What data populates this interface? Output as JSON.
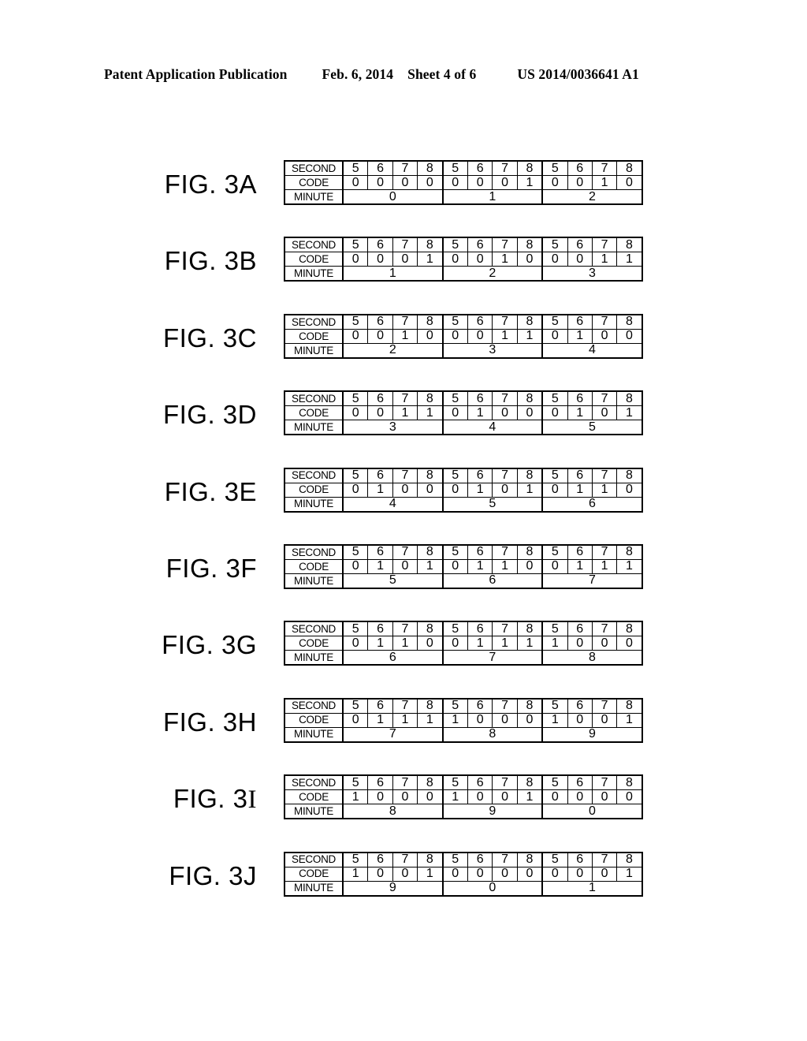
{
  "header": {
    "publication": "Patent Application Publication",
    "date": "Feb. 6, 2014",
    "sheet": "Sheet 4 of 6",
    "patent_number": "US 2014/0036641 A1"
  },
  "table_row_labels": {
    "second": "SECOND",
    "code": "CODE",
    "minute": "MINUTE"
  },
  "seconds_header": [
    "5",
    "6",
    "7",
    "8",
    "5",
    "6",
    "7",
    "8",
    "5",
    "6",
    "7",
    "8"
  ],
  "figures": [
    {
      "label_prefix": "FIG. 3",
      "label_suffix": "A",
      "label_full": "FIG. 3A",
      "second": [
        "5",
        "6",
        "7",
        "8",
        "5",
        "6",
        "7",
        "8",
        "5",
        "6",
        "7",
        "8"
      ],
      "code": [
        "0",
        "0",
        "0",
        "0",
        "0",
        "0",
        "0",
        "1",
        "0",
        "0",
        "1",
        "0"
      ],
      "minute": [
        "0",
        "1",
        "2"
      ]
    },
    {
      "label_prefix": "FIG. 3",
      "label_suffix": "B",
      "label_full": "FIG. 3B",
      "second": [
        "5",
        "6",
        "7",
        "8",
        "5",
        "6",
        "7",
        "8",
        "5",
        "6",
        "7",
        "8"
      ],
      "code": [
        "0",
        "0",
        "0",
        "1",
        "0",
        "0",
        "1",
        "0",
        "0",
        "0",
        "1",
        "1"
      ],
      "minute": [
        "1",
        "2",
        "3"
      ]
    },
    {
      "label_prefix": "FIG. 3",
      "label_suffix": "C",
      "label_full": "FIG. 3C",
      "second": [
        "5",
        "6",
        "7",
        "8",
        "5",
        "6",
        "7",
        "8",
        "5",
        "6",
        "7",
        "8"
      ],
      "code": [
        "0",
        "0",
        "1",
        "0",
        "0",
        "0",
        "1",
        "1",
        "0",
        "1",
        "0",
        "0"
      ],
      "minute": [
        "2",
        "3",
        "4"
      ]
    },
    {
      "label_prefix": "FIG. 3",
      "label_suffix": "D",
      "label_full": "FIG. 3D",
      "second": [
        "5",
        "6",
        "7",
        "8",
        "5",
        "6",
        "7",
        "8",
        "5",
        "6",
        "7",
        "8"
      ],
      "code": [
        "0",
        "0",
        "1",
        "1",
        "0",
        "1",
        "0",
        "0",
        "0",
        "1",
        "0",
        "1"
      ],
      "minute": [
        "3",
        "4",
        "5"
      ]
    },
    {
      "label_prefix": "FIG. 3",
      "label_suffix": "E",
      "label_full": "FIG. 3E",
      "second": [
        "5",
        "6",
        "7",
        "8",
        "5",
        "6",
        "7",
        "8",
        "5",
        "6",
        "7",
        "8"
      ],
      "code": [
        "0",
        "1",
        "0",
        "0",
        "0",
        "1",
        "0",
        "1",
        "0",
        "1",
        "1",
        "0"
      ],
      "minute": [
        "4",
        "5",
        "6"
      ]
    },
    {
      "label_prefix": "FIG. 3",
      "label_suffix": "F",
      "label_full": "FIG. 3F",
      "second": [
        "5",
        "6",
        "7",
        "8",
        "5",
        "6",
        "7",
        "8",
        "5",
        "6",
        "7",
        "8"
      ],
      "code": [
        "0",
        "1",
        "0",
        "1",
        "0",
        "1",
        "1",
        "0",
        "0",
        "1",
        "1",
        "1"
      ],
      "minute": [
        "5",
        "6",
        "7"
      ]
    },
    {
      "label_prefix": "FIG. 3",
      "label_suffix": "G",
      "label_full": "FIG. 3G",
      "second": [
        "5",
        "6",
        "7",
        "8",
        "5",
        "6",
        "7",
        "8",
        "5",
        "6",
        "7",
        "8"
      ],
      "code": [
        "0",
        "1",
        "1",
        "0",
        "0",
        "1",
        "1",
        "1",
        "1",
        "0",
        "0",
        "0"
      ],
      "minute": [
        "6",
        "7",
        "8"
      ]
    },
    {
      "label_prefix": "FIG. 3",
      "label_suffix": "H",
      "label_full": "FIG. 3H",
      "second": [
        "5",
        "6",
        "7",
        "8",
        "5",
        "6",
        "7",
        "8",
        "5",
        "6",
        "7",
        "8"
      ],
      "code": [
        "0",
        "1",
        "1",
        "1",
        "1",
        "0",
        "0",
        "0",
        "1",
        "0",
        "0",
        "1"
      ],
      "minute": [
        "7",
        "8",
        "9"
      ]
    },
    {
      "label_prefix": "FIG. 3",
      "label_suffix": "I",
      "label_full": "FIG. 3I",
      "second": [
        "5",
        "6",
        "7",
        "8",
        "5",
        "6",
        "7",
        "8",
        "5",
        "6",
        "7",
        "8"
      ],
      "code": [
        "1",
        "0",
        "0",
        "0",
        "1",
        "0",
        "0",
        "1",
        "0",
        "0",
        "0",
        "0"
      ],
      "minute": [
        "8",
        "9",
        "0"
      ]
    },
    {
      "label_prefix": "FIG. 3",
      "label_suffix": "J",
      "label_full": "FIG. 3J",
      "second": [
        "5",
        "6",
        "7",
        "8",
        "5",
        "6",
        "7",
        "8",
        "5",
        "6",
        "7",
        "8"
      ],
      "code": [
        "1",
        "0",
        "0",
        "1",
        "0",
        "0",
        "0",
        "0",
        "0",
        "0",
        "0",
        "1"
      ],
      "minute": [
        "9",
        "0",
        "1"
      ]
    }
  ]
}
